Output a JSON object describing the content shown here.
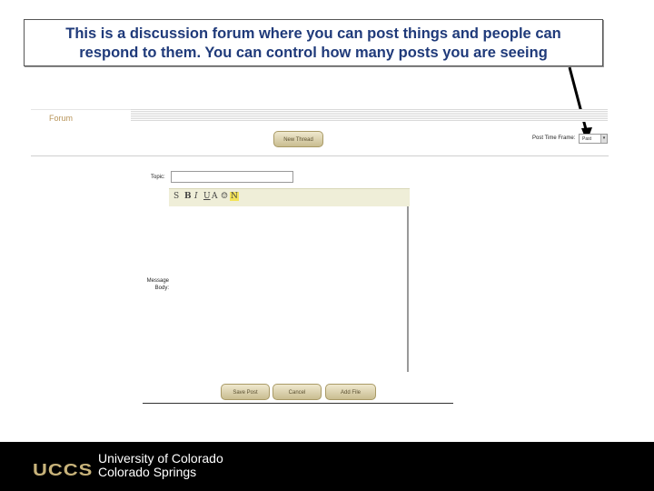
{
  "callout": {
    "line1": "This is a discussion forum where you can post things and people can",
    "line2": "respond to them.  You can control how many posts you are seeing"
  },
  "forum": {
    "tab_label": "Forum",
    "new_thread_button": "New Thread",
    "post_time_frame_label": "Post Time Frame:",
    "post_time_frame_value": "Past"
  },
  "compose": {
    "topic_label": "Topic:",
    "toolbar_icons": [
      "spellcheck-icon",
      "bold-icon",
      "italic-icon",
      "underline-icon",
      "font-color-icon",
      "emoticon-icon",
      "link-icon"
    ],
    "toolbar_glyphs": [
      "S",
      "B",
      "I",
      "U",
      "A",
      "☺",
      "N"
    ],
    "message_body_label_1": "Message",
    "message_body_label_2": "Body:",
    "buttons": {
      "save": "Save Post",
      "cancel": "Cancel",
      "add_file": "Add File"
    }
  },
  "footer": {
    "logo": "UCCS",
    "line1": "University of Colorado",
    "line2": "Colorado Springs"
  },
  "colors": {
    "callout_text": "#1f3a7a",
    "gold": "#c8b37a",
    "footer_bg": "#000000"
  }
}
